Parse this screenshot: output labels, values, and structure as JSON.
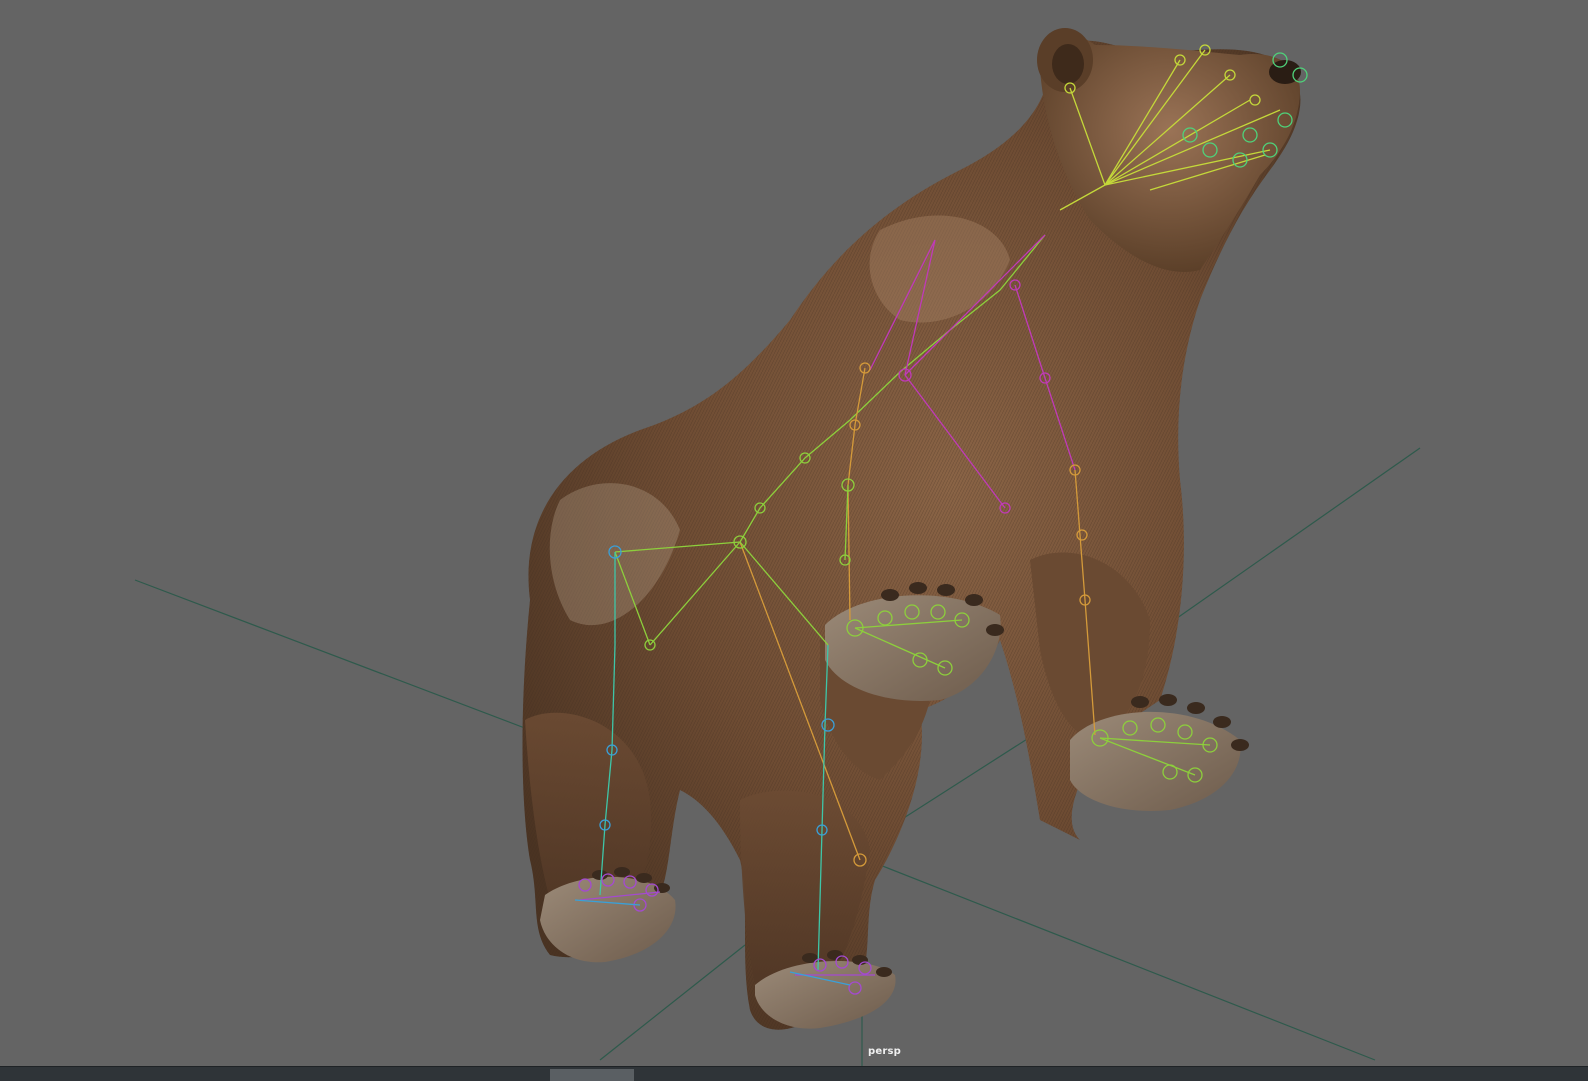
{
  "viewport": {
    "camera_label": "persp",
    "background_color": "#646464",
    "grid_color": "#2e5a4c",
    "model": "bear-with-skeleton-rig"
  },
  "timebar": {
    "background_color": "#2f3438",
    "slider_color": "#5a5f63"
  }
}
